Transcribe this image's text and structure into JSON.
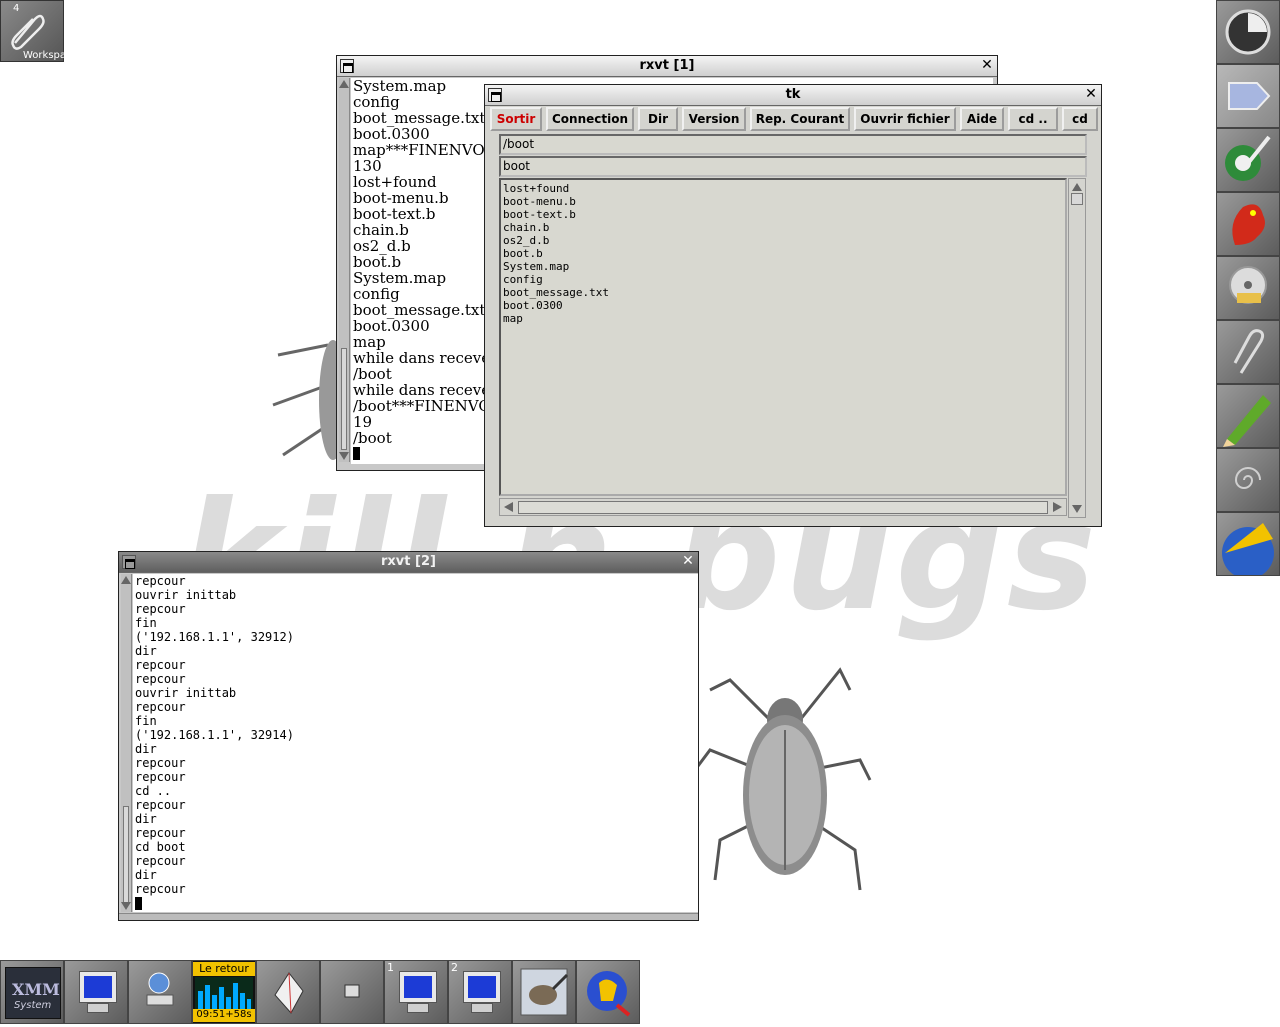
{
  "desktop": {
    "wallpaper_text": "kill  n  bugs",
    "workspace": {
      "number": "4",
      "label": "Workspace"
    }
  },
  "rxvt1": {
    "title": "rxvt  [1]",
    "lines": [
      "System.map",
      "config",
      "boot_message.txt",
      "boot.0300",
      "map***FINENVOI***",
      "130",
      "lost+found",
      "boot-menu.b",
      "boot-text.b",
      "chain.b",
      "os2_d.b",
      "boot.b",
      "System.map",
      "config",
      "boot_message.txt",
      "boot.0300",
      "map",
      "while dans receve",
      "/boot",
      "while dans receve",
      "/boot***FINENVOI***",
      "19",
      "/boot"
    ]
  },
  "tk": {
    "title": "tk",
    "buttons": [
      {
        "label": "Sortir",
        "color": "#cc0000"
      },
      {
        "label": "Connection"
      },
      {
        "label": "Dir"
      },
      {
        "label": "Version"
      },
      {
        "label": "Rep. Courant"
      },
      {
        "label": "Ouvrir fichier"
      },
      {
        "label": "Aide"
      },
      {
        "label": "cd .."
      },
      {
        "label": "cd"
      }
    ],
    "path_value": "/boot",
    "entry_value": "boot",
    "files": [
      "lost+found",
      "boot-menu.b",
      "boot-text.b",
      "chain.b",
      "os2_d.b",
      "boot.b",
      "System.map",
      "config",
      "boot_message.txt",
      "boot.0300",
      "map"
    ]
  },
  "rxvt2": {
    "title": "rxvt  [2]",
    "lines": [
      "repcour",
      "ouvrir inittab",
      "repcour",
      "fin",
      "('192.168.1.1', 32912)",
      "dir",
      "repcour",
      "repcour",
      "ouvrir inittab",
      "repcour",
      "fin",
      "('192.168.1.1', 32914)",
      "dir",
      "repcour",
      "repcour",
      "cd ..",
      "repcour",
      "dir",
      "repcour",
      "cd boot",
      "repcour",
      "dir",
      "repcour"
    ]
  },
  "taskbar": {
    "xmms_label_1": "XMM",
    "xmms_label_2": "System",
    "player_title": "Le retour",
    "player_time": "09:51+58s",
    "desk1": "1",
    "desk2": "2"
  },
  "colors": {
    "accent": "#cc0000",
    "screen_blue": "#1c3bd6",
    "panel_yellow": "#f2c200"
  },
  "dock": {
    "icons": [
      "circle-logo-icon",
      "blank-dock-icon",
      "paint-brush-icon",
      "red-dragon-icon",
      "cd-burner-icon",
      "paperclip-icon",
      "pencil-icon",
      "spiral-icon",
      "earth-icon"
    ]
  }
}
